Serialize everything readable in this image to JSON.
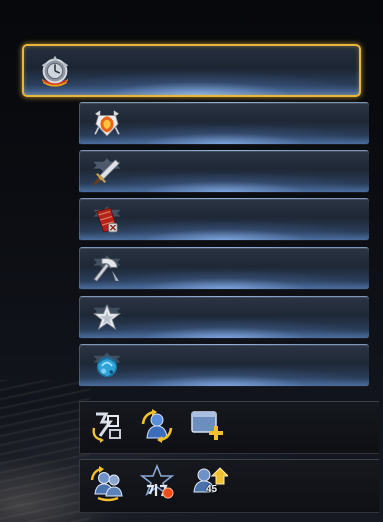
{
  "menu": {
    "rows": [
      {
        "key": "all",
        "icon": "compass-clock-icon",
        "selected": true
      },
      {
        "key": "fire-armor",
        "icon": "flame-armor-icon",
        "selected": false
      },
      {
        "key": "weapon",
        "icon": "dagger-icon",
        "selected": false
      },
      {
        "key": "scroll",
        "icon": "red-scroll-icon",
        "selected": false
      },
      {
        "key": "craft",
        "icon": "hammer-icon",
        "selected": false
      },
      {
        "key": "star",
        "icon": "silver-star-icon",
        "selected": false
      },
      {
        "key": "gem",
        "icon": "blue-gem-icon",
        "selected": false
      }
    ]
  },
  "toolbar_top": {
    "icons": [
      "rename-icon",
      "character-refresh-icon",
      "add-window-icon"
    ]
  },
  "toolbar_bottom": {
    "icons": [
      "swap-character-icon",
      "rank-star-icon",
      "level-up-icon"
    ],
    "level_badge": "45"
  },
  "colors": {
    "selected_border": "#e8b63a",
    "row_glow": "#4a6d9c"
  }
}
